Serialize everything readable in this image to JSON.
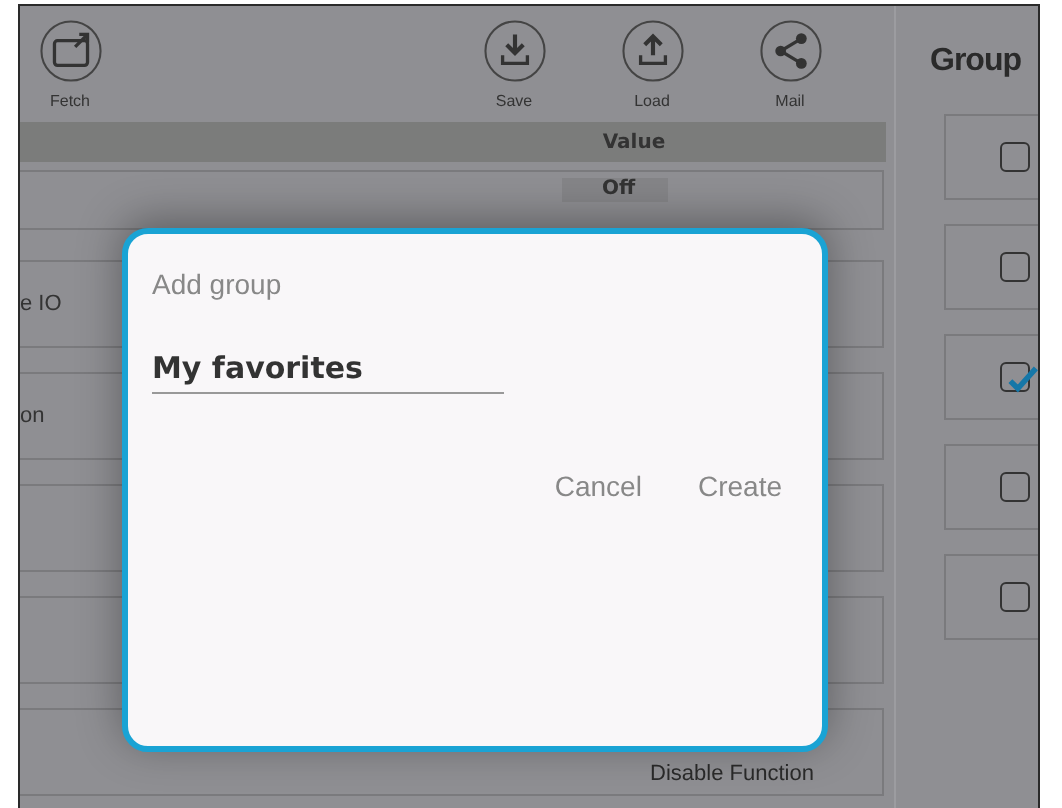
{
  "toolbar": {
    "buttons": [
      {
        "label": "Fetch",
        "kind": "fetch"
      },
      {
        "label": "Save",
        "kind": "save"
      },
      {
        "label": "Load",
        "kind": "load"
      },
      {
        "label": "Mail",
        "kind": "share"
      }
    ]
  },
  "table": {
    "columns": [
      {
        "label": "Value"
      }
    ],
    "rows": [
      {
        "value": "Off",
        "kind": "chip"
      },
      {
        "name": "e IO"
      },
      {
        "name": "on"
      },
      {},
      {},
      {
        "value": "Disable Function",
        "kind": "text"
      }
    ]
  },
  "groups_panel": {
    "title": "Group",
    "items": [
      {
        "checked": false
      },
      {
        "checked": false
      },
      {
        "checked": true
      },
      {
        "checked": false
      },
      {
        "checked": false
      }
    ]
  },
  "dialog": {
    "title": "Add group",
    "field": {
      "value": "My favorites"
    },
    "buttons": [
      {
        "label": "Cancel"
      },
      {
        "label": "Create"
      }
    ]
  }
}
